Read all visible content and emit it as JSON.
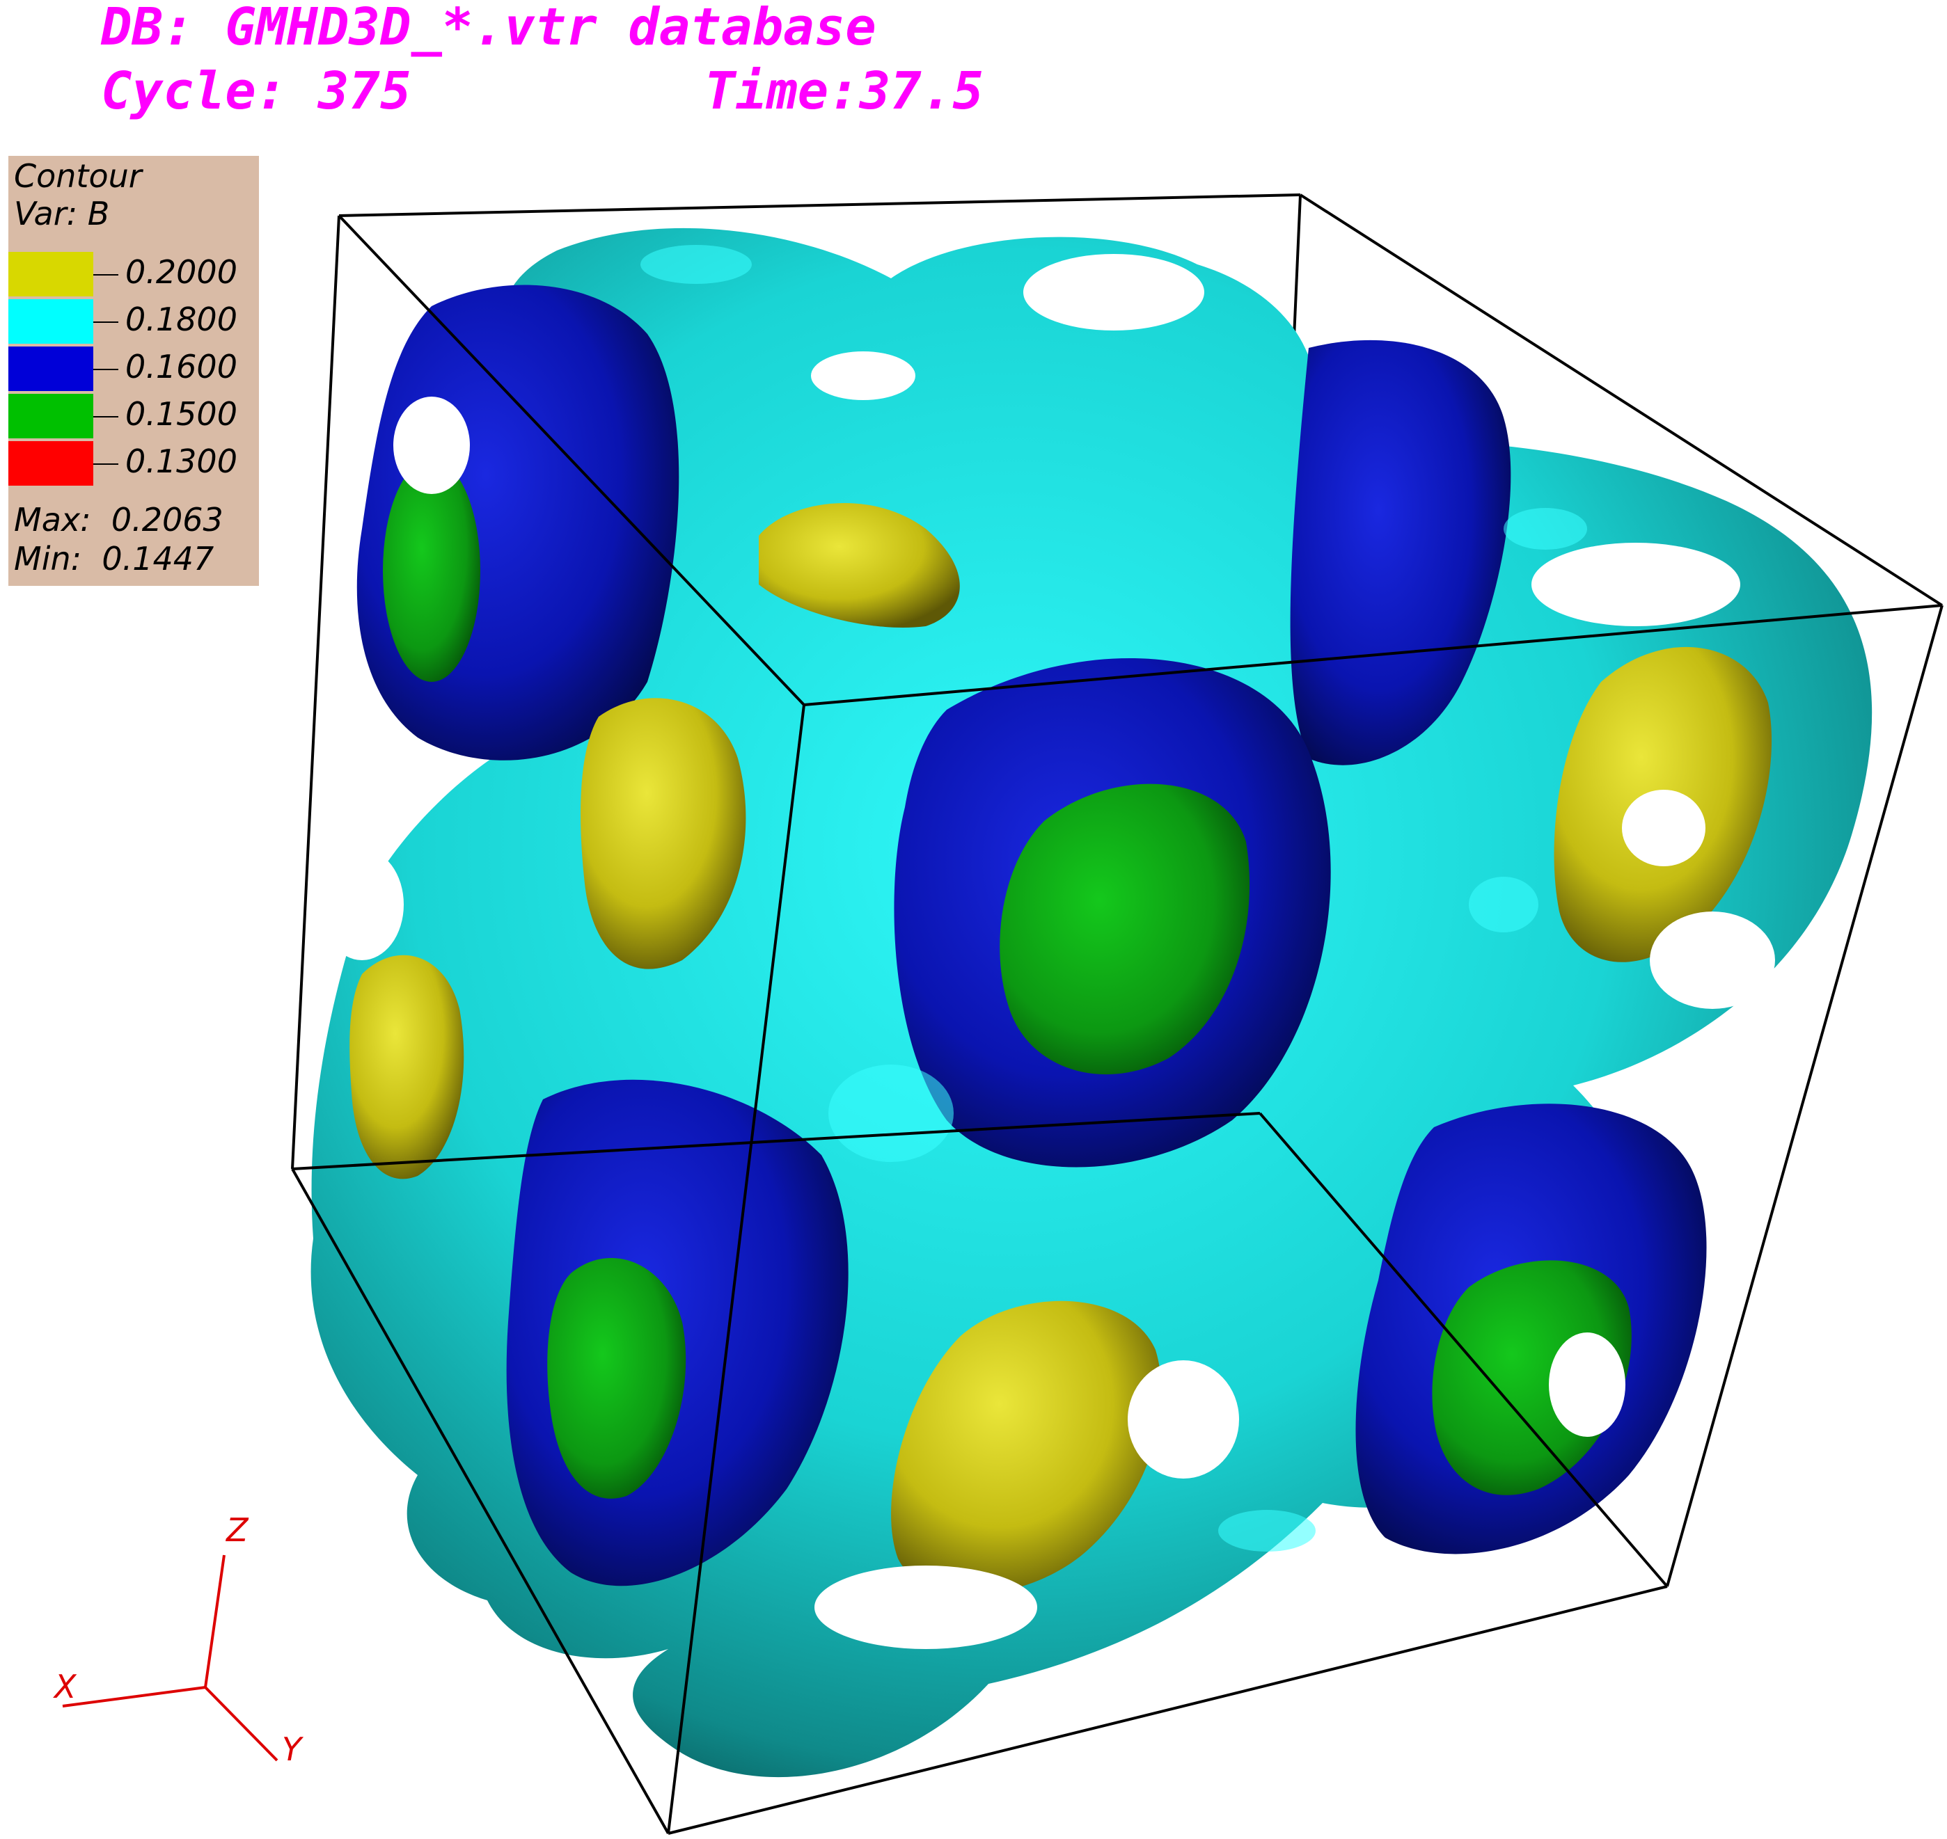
{
  "header": {
    "db_line": "DB: GMHD3D_*.vtr database",
    "cycle": "Cycle: 375",
    "time": "Time:37.5",
    "color": "#ff00ff"
  },
  "legend": {
    "title_1": "Contour",
    "title_2": "Var: B",
    "background": "#d9bba6",
    "levels": [
      {
        "label": "0.2000",
        "color": "#d8d800"
      },
      {
        "label": "0.1800",
        "color": "#00ffff"
      },
      {
        "label": "0.1600",
        "color": "#0000d8"
      },
      {
        "label": "0.1500",
        "color": "#00c000"
      },
      {
        "label": "0.1300",
        "color": "#ff0000"
      }
    ],
    "max": "Max:  0.2063",
    "min": "Min:  0.1447"
  },
  "triad": {
    "x": "X",
    "y": "Y",
    "z": "Z",
    "color": "#dd0000"
  },
  "surface_colors": {
    "cyan": "#1fcfcf",
    "blue": "#0a12a8",
    "green": "#0c9c12",
    "yellow": "#c8c010",
    "edge": "#000000"
  }
}
